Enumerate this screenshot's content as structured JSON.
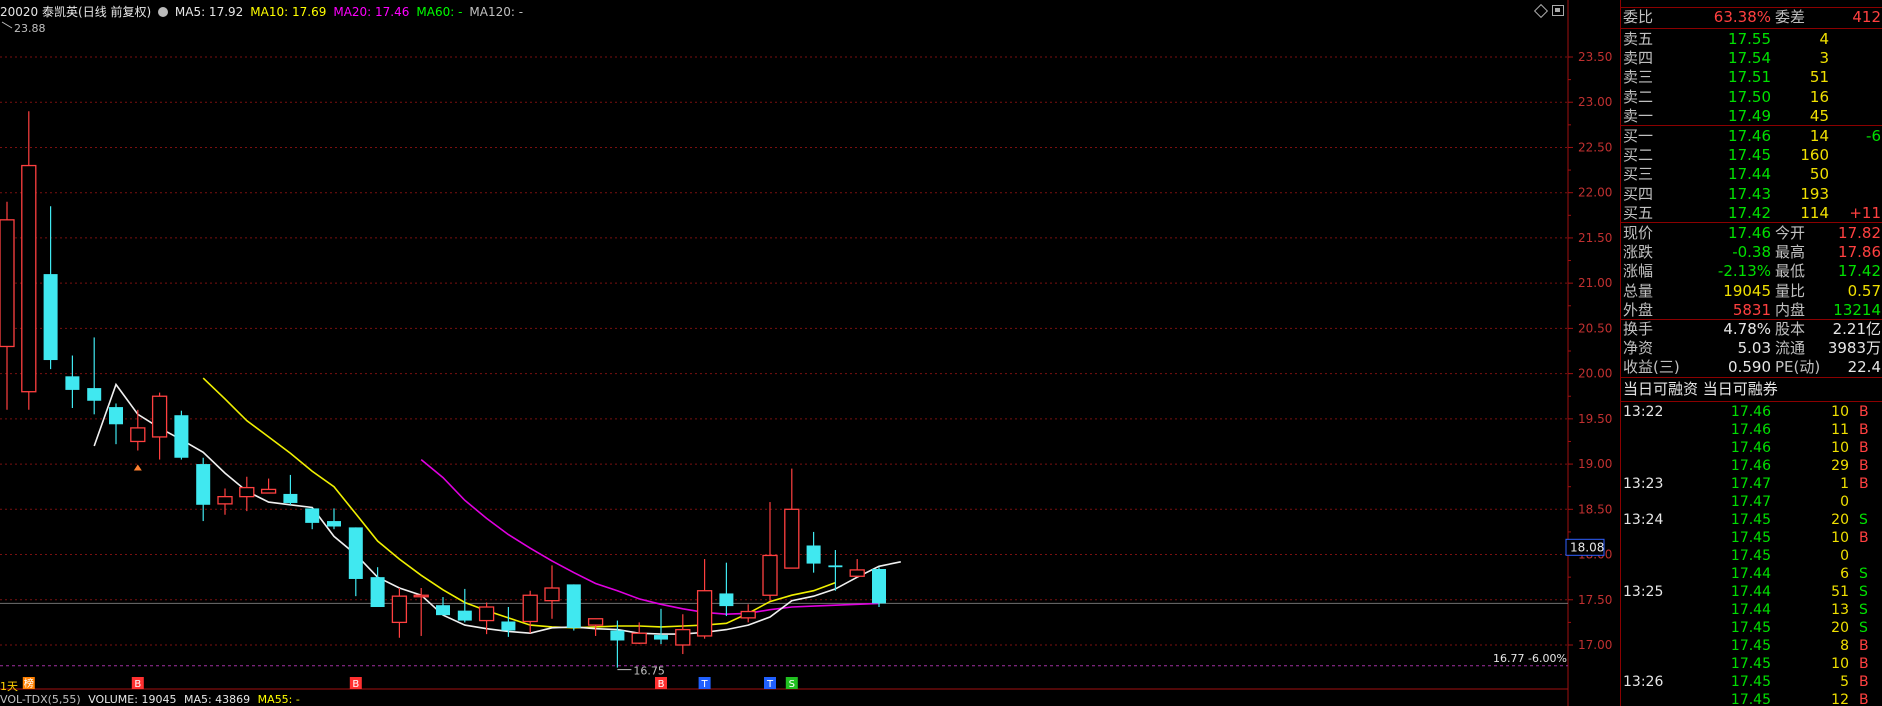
{
  "header": {
    "code": "20020",
    "name": "泰凯英",
    "period": "(日线 前复权)",
    "ma_labels": [
      {
        "text": "MA5: 17.92",
        "color": "#e6e6e6"
      },
      {
        "text": "MA10: 17.69",
        "color": "#ffff00"
      },
      {
        "text": "MA20: 17.46",
        "color": "#ff00ff"
      },
      {
        "text": "MA60: -",
        "color": "#00ff00"
      },
      {
        "text": "MA120: -",
        "color": "#c0c0c0"
      }
    ]
  },
  "volume_header": {
    "items": [
      "VOL-TDX(5,55)",
      "VOLUME: 19045",
      "MA5: 43869",
      "MA55: -"
    ]
  },
  "chart_data": {
    "type": "candlestick",
    "y_axis": {
      "ticks": [
        "23.50",
        "23.00",
        "22.50",
        "22.00",
        "21.50",
        "21.00",
        "20.50",
        "20.00",
        "19.50",
        "19.00",
        "18.50",
        "18.00",
        "17.50",
        "17.00"
      ],
      "range": [
        16.55,
        24.0
      ]
    },
    "candles": [
      {
        "o": 20.3,
        "c": 21.7,
        "h": 21.9,
        "l": 19.6
      },
      {
        "o": 19.8,
        "c": 22.3,
        "h": 22.9,
        "l": 19.6
      },
      {
        "o": 21.1,
        "c": 20.15,
        "h": 21.85,
        "l": 20.05
      },
      {
        "o": 19.97,
        "c": 19.82,
        "h": 20.2,
        "l": 19.62
      },
      {
        "o": 19.84,
        "c": 19.7,
        "h": 20.4,
        "l": 19.55
      },
      {
        "o": 19.63,
        "c": 19.44,
        "h": 19.67,
        "l": 19.22
      },
      {
        "o": 19.25,
        "c": 19.4,
        "h": 19.6,
        "l": 19.15
      },
      {
        "o": 19.3,
        "c": 19.75,
        "h": 19.79,
        "l": 19.05
      },
      {
        "o": 19.54,
        "c": 19.07,
        "h": 19.59,
        "l": 19.05
      },
      {
        "o": 19.0,
        "c": 18.55,
        "h": 19.07,
        "l": 18.37
      },
      {
        "o": 18.56,
        "c": 18.64,
        "h": 18.73,
        "l": 18.44
      },
      {
        "o": 18.64,
        "c": 18.74,
        "h": 18.86,
        "l": 18.48
      },
      {
        "o": 18.68,
        "c": 18.72,
        "h": 18.84,
        "l": 18.68
      },
      {
        "o": 18.67,
        "c": 18.57,
        "h": 18.88,
        "l": 18.55
      },
      {
        "o": 18.51,
        "c": 18.35,
        "h": 18.51,
        "l": 18.28
      },
      {
        "o": 18.37,
        "c": 18.31,
        "h": 18.51,
        "l": 18.28
      },
      {
        "o": 18.3,
        "c": 17.73,
        "h": 18.3,
        "l": 17.54
      },
      {
        "o": 17.75,
        "c": 17.42,
        "h": 17.86,
        "l": 17.42
      },
      {
        "o": 17.25,
        "c": 17.54,
        "h": 17.63,
        "l": 17.08
      },
      {
        "o": 17.55,
        "c": 17.55,
        "h": 17.63,
        "l": 17.1
      },
      {
        "o": 17.44,
        "c": 17.33,
        "h": 17.53,
        "l": 17.33
      },
      {
        "o": 17.38,
        "c": 17.27,
        "h": 17.62,
        "l": 17.25
      },
      {
        "o": 17.27,
        "c": 17.42,
        "h": 17.47,
        "l": 17.12
      },
      {
        "o": 17.26,
        "c": 17.16,
        "h": 17.42,
        "l": 17.09
      },
      {
        "o": 17.26,
        "c": 17.55,
        "h": 17.6,
        "l": 17.13
      },
      {
        "o": 17.49,
        "c": 17.63,
        "h": 17.88,
        "l": 17.29
      },
      {
        "o": 17.67,
        "c": 17.19,
        "h": 17.67,
        "l": 17.16
      },
      {
        "o": 17.22,
        "c": 17.29,
        "h": 17.29,
        "l": 17.1
      },
      {
        "o": 17.16,
        "c": 17.05,
        "h": 17.27,
        "l": 16.75
      },
      {
        "o": 17.02,
        "c": 17.13,
        "h": 17.25,
        "l": 17.01
      },
      {
        "o": 17.11,
        "c": 17.06,
        "h": 17.4,
        "l": 17.01
      },
      {
        "o": 17.0,
        "c": 17.17,
        "h": 17.34,
        "l": 16.9
      },
      {
        "o": 17.1,
        "c": 17.6,
        "h": 17.95,
        "l": 17.07
      },
      {
        "o": 17.57,
        "c": 17.43,
        "h": 17.91,
        "l": 17.32
      },
      {
        "o": 17.3,
        "c": 17.37,
        "h": 17.45,
        "l": 17.25
      },
      {
        "o": 17.55,
        "c": 17.99,
        "h": 18.58,
        "l": 17.49
      },
      {
        "o": 17.85,
        "c": 18.5,
        "h": 18.95,
        "l": 17.85
      },
      {
        "o": 18.1,
        "c": 17.9,
        "h": 18.25,
        "l": 17.8
      },
      {
        "o": 17.88,
        "c": 17.86,
        "h": 18.05,
        "l": 17.6
      },
      {
        "o": 17.76,
        "c": 17.83,
        "h": 17.95,
        "l": 17.75
      },
      {
        "o": 17.84,
        "c": 17.46,
        "h": 17.86,
        "l": 17.42
      }
    ],
    "ma5": [
      null,
      null,
      null,
      null,
      19.2,
      19.88,
      19.55,
      19.4,
      19.27,
      19.13,
      18.9,
      18.7,
      18.58,
      18.55,
      18.52,
      18.2,
      18.0,
      17.75,
      17.63,
      17.55,
      17.33,
      17.22,
      17.18,
      17.15,
      17.13,
      17.19,
      17.2,
      17.18,
      17.17,
      17.13,
      17.12,
      17.12,
      17.14,
      17.17,
      17.22,
      17.31,
      17.49,
      17.54,
      17.62,
      17.75,
      17.87,
      17.92
    ],
    "ma10": [
      null,
      null,
      null,
      null,
      null,
      null,
      null,
      null,
      null,
      19.95,
      19.72,
      19.48,
      19.3,
      19.12,
      18.92,
      18.75,
      18.45,
      18.15,
      17.95,
      17.77,
      17.61,
      17.47,
      17.38,
      17.3,
      17.22,
      17.2,
      17.19,
      17.2,
      17.21,
      17.21,
      17.2,
      17.21,
      17.22,
      17.24,
      17.35,
      17.48,
      17.55,
      17.6,
      17.69
    ],
    "ma20": [
      null,
      null,
      null,
      null,
      null,
      null,
      null,
      null,
      null,
      null,
      null,
      null,
      null,
      null,
      null,
      null,
      null,
      null,
      null,
      19.05,
      18.85,
      18.6,
      18.4,
      18.22,
      18.07,
      17.93,
      17.8,
      17.68,
      17.6,
      17.51,
      17.45,
      17.4,
      17.36,
      17.34,
      17.35,
      17.39,
      17.42,
      17.43,
      17.44,
      17.45,
      17.46
    ],
    "labels": {
      "high": "23.88",
      "low": "16.75",
      "current_line": "16.77 -6.00%",
      "price_tag": "18.08"
    },
    "markers": [
      {
        "i": 1,
        "text": "榜",
        "color": "#ff8000"
      },
      {
        "i": 6,
        "text": "B",
        "color": "#ff3030"
      },
      {
        "i": 16,
        "text": "B",
        "color": "#ff3030"
      },
      {
        "i": 30,
        "text": "B",
        "color": "#ff3030"
      },
      {
        "i": 32,
        "text": "T",
        "color": "#2060ff"
      },
      {
        "i": 35,
        "text": "T",
        "color": "#2060ff"
      },
      {
        "i": 36,
        "text": "S",
        "color": "#20c020"
      }
    ],
    "period_tag": "1天"
  },
  "panel": {
    "weibi": {
      "label": "委比",
      "value": "63.38%",
      "label2": "委差",
      "value2": "412"
    },
    "asks": [
      {
        "label": "卖五",
        "price": "17.55",
        "vol": "4"
      },
      {
        "label": "卖四",
        "price": "17.54",
        "vol": "3"
      },
      {
        "label": "卖三",
        "price": "17.51",
        "vol": "51"
      },
      {
        "label": "卖二",
        "price": "17.50",
        "vol": "16"
      },
      {
        "label": "卖一",
        "price": "17.49",
        "vol": "45"
      }
    ],
    "bids": [
      {
        "label": "买一",
        "price": "17.46",
        "vol": "14",
        "chg": "-6"
      },
      {
        "label": "买二",
        "price": "17.45",
        "vol": "160",
        "chg": ""
      },
      {
        "label": "买三",
        "price": "17.44",
        "vol": "50",
        "chg": ""
      },
      {
        "label": "买四",
        "price": "17.43",
        "vol": "193",
        "chg": ""
      },
      {
        "label": "买五",
        "price": "17.42",
        "vol": "114",
        "chg": "+11"
      }
    ],
    "quote": [
      {
        "l1": "现价",
        "v1": "17.46",
        "c1": "green",
        "l2": "今开",
        "v2": "17.82",
        "c2": "red"
      },
      {
        "l1": "涨跌",
        "v1": "-0.38",
        "c1": "green",
        "l2": "最高",
        "v2": "17.86",
        "c2": "red"
      },
      {
        "l1": "涨幅",
        "v1": "-2.13%",
        "c1": "green",
        "l2": "最低",
        "v2": "17.42",
        "c2": "green"
      },
      {
        "l1": "总量",
        "v1": "19045",
        "c1": "yellow",
        "l2": "量比",
        "v2": "0.57",
        "c2": "yellow"
      },
      {
        "l1": "外盘",
        "v1": "5831",
        "c1": "red",
        "l2": "内盘",
        "v2": "13214",
        "c2": "green"
      }
    ],
    "stats": [
      {
        "l1": "换手",
        "v1": "4.78%",
        "l2": "股本",
        "v2": "2.21亿"
      },
      {
        "l1": "净资",
        "v1": "5.03",
        "l2": "流通",
        "v2": "3983万"
      },
      {
        "l1": "收益(三)",
        "v1": "0.590",
        "l2": "PE(动)",
        "v2": "22.4"
      }
    ],
    "margin_title": "当日可融资 当日可融券",
    "ticks": [
      {
        "t": "13:22",
        "p": "17.46",
        "v": "10",
        "s": "B"
      },
      {
        "t": "",
        "p": "17.46",
        "v": "11",
        "s": "B"
      },
      {
        "t": "",
        "p": "17.46",
        "v": "10",
        "s": "B"
      },
      {
        "t": "",
        "p": "17.46",
        "v": "29",
        "s": "B"
      },
      {
        "t": "13:23",
        "p": "17.47",
        "v": "1",
        "s": "B"
      },
      {
        "t": "",
        "p": "17.47",
        "v": "0",
        "s": ""
      },
      {
        "t": "13:24",
        "p": "17.45",
        "v": "20",
        "s": "S"
      },
      {
        "t": "",
        "p": "17.45",
        "v": "10",
        "s": "B"
      },
      {
        "t": "",
        "p": "17.45",
        "v": "0",
        "s": ""
      },
      {
        "t": "",
        "p": "17.44",
        "v": "6",
        "s": "S"
      },
      {
        "t": "13:25",
        "p": "17.44",
        "v": "51",
        "s": "S"
      },
      {
        "t": "",
        "p": "17.44",
        "v": "13",
        "s": "S"
      },
      {
        "t": "",
        "p": "17.45",
        "v": "20",
        "s": "S"
      },
      {
        "t": "",
        "p": "17.45",
        "v": "8",
        "s": "B"
      },
      {
        "t": "",
        "p": "17.45",
        "v": "10",
        "s": "B"
      },
      {
        "t": "13:26",
        "p": "17.45",
        "v": "5",
        "s": "B"
      },
      {
        "t": "",
        "p": "17.45",
        "v": "12",
        "s": "B"
      }
    ]
  }
}
